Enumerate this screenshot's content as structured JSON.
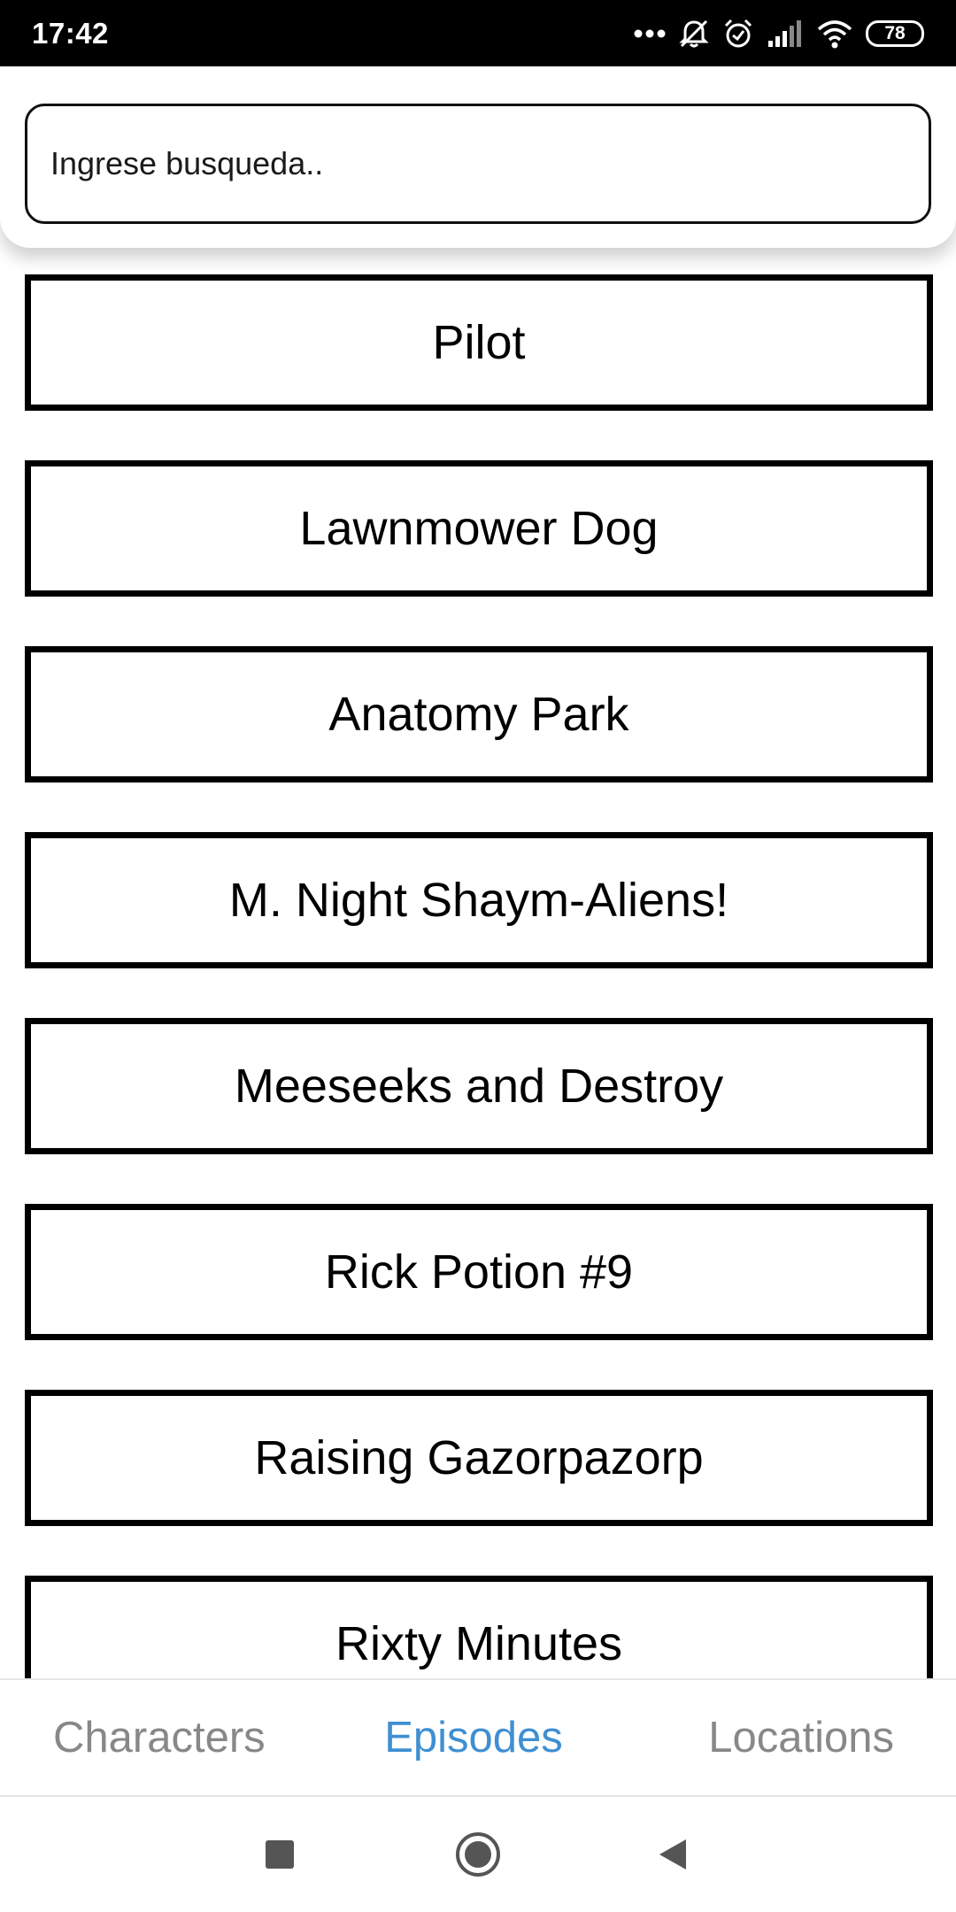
{
  "status_bar": {
    "time": "17:42",
    "battery_level": "78",
    "icons": [
      "more-dots-icon",
      "notifications-off-icon",
      "alarm-icon",
      "signal-icon",
      "wifi-icon",
      "battery-icon"
    ]
  },
  "search": {
    "placeholder": "Ingrese busqueda..",
    "value": ""
  },
  "episodes": [
    "Pilot",
    "Lawnmower Dog",
    "Anatomy Park",
    "M. Night Shaym-Aliens!",
    "Meeseeks and Destroy",
    "Rick Potion #9",
    "Raising Gazorpazorp",
    "Rixty Minutes"
  ],
  "tabs": {
    "characters": "Characters",
    "episodes": "Episodes",
    "locations": "Locations",
    "active": "Episodes"
  },
  "colors": {
    "active_tab": "#3f8fd2",
    "inactive_tab": "#888888",
    "card_border": "#000000",
    "status_bar": "#000000"
  },
  "nav_bar": {
    "icons": [
      "recents-square-icon",
      "home-circle-icon",
      "back-triangle-icon"
    ]
  }
}
